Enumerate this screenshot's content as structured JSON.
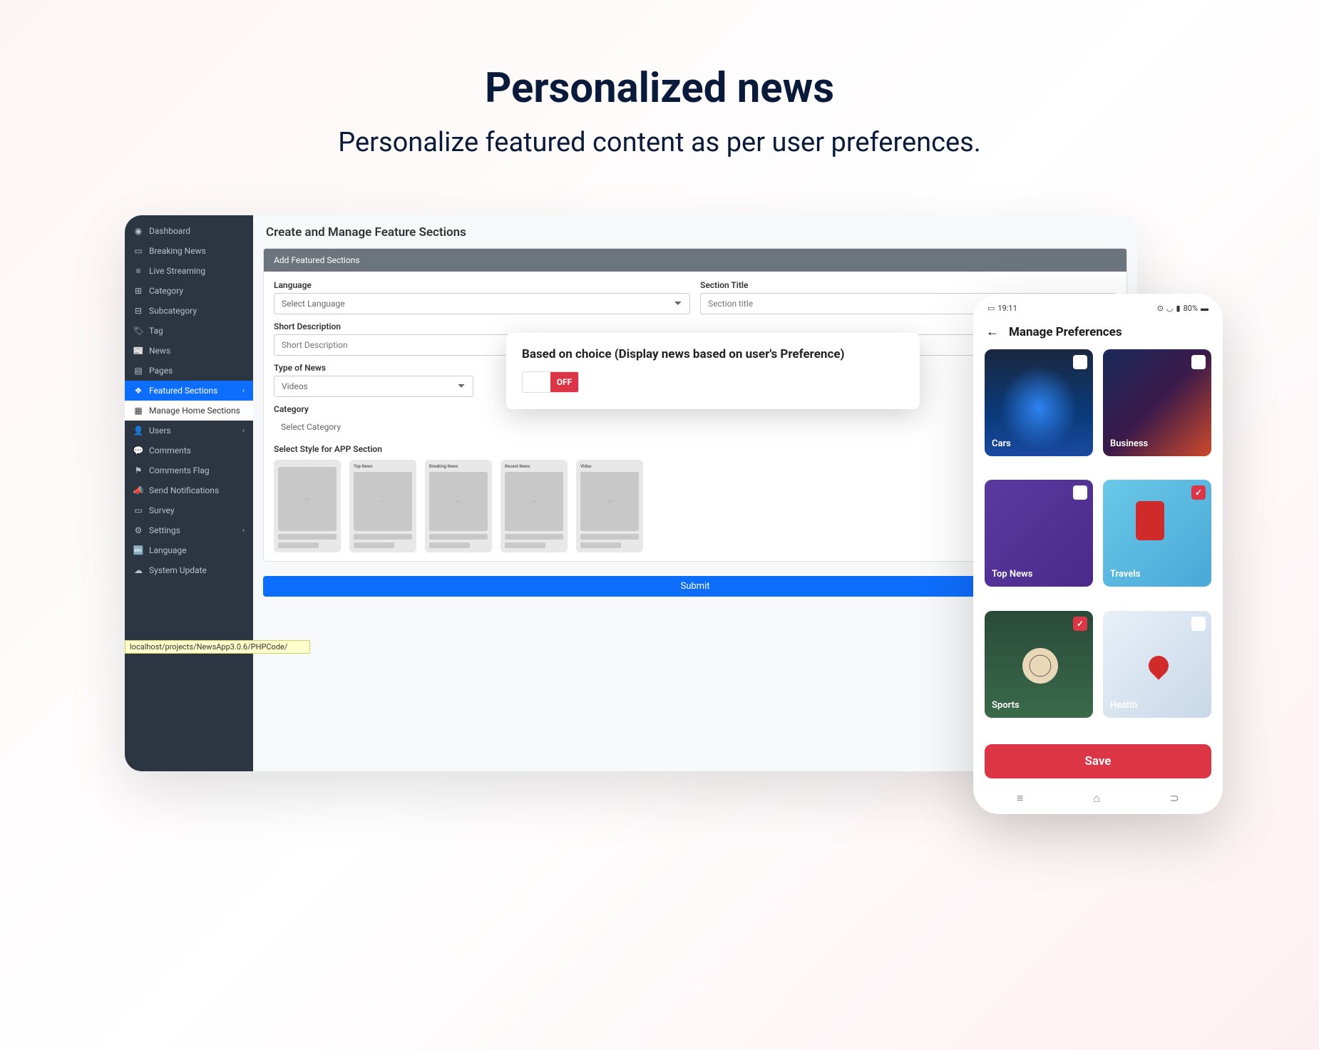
{
  "hero": {
    "title": "Personalized news",
    "subtitle": "Personalize featured content as per user preferences."
  },
  "sidebar": {
    "items": [
      {
        "icon": "◉",
        "label": "Dashboard"
      },
      {
        "icon": "▭",
        "label": "Breaking News"
      },
      {
        "icon": "≡",
        "label": "Live Streaming"
      },
      {
        "icon": "⊞",
        "label": "Category"
      },
      {
        "icon": "⊟",
        "label": "Subcategory"
      },
      {
        "icon": "🏷",
        "label": "Tag"
      },
      {
        "icon": "📰",
        "label": "News"
      },
      {
        "icon": "▤",
        "label": "Pages"
      },
      {
        "icon": "❖",
        "label": "Featured Sections",
        "active": true,
        "chev": "‹"
      },
      {
        "icon": "▦",
        "label": "Manage Home Sections",
        "sub": true
      },
      {
        "icon": "👤",
        "label": "Users",
        "chev": "‹"
      },
      {
        "icon": "💬",
        "label": "Comments"
      },
      {
        "icon": "⚑",
        "label": "Comments Flag"
      },
      {
        "icon": "📣",
        "label": "Send Notifications"
      },
      {
        "icon": "▭",
        "label": "Survey"
      },
      {
        "icon": "⚙",
        "label": "Settings",
        "chev": "‹"
      },
      {
        "icon": "🔤",
        "label": "Language"
      },
      {
        "icon": "☁",
        "label": "System Update"
      }
    ],
    "url": "localhost/projects/NewsApp3.0.6/PHPCode/"
  },
  "main": {
    "title": "Create and Manage Feature Sections",
    "card_head": "Add Featured Sections",
    "lang_label": "Language",
    "lang_value": "Select Language",
    "section_title_label": "Section Title",
    "section_title_ph": "Section title",
    "short_desc_label": "Short Description",
    "short_desc_ph": "Short Description",
    "type_label": "Type of News",
    "type_value": "Videos",
    "cat_label": "Category",
    "cat_value": "Select Category",
    "style_label": "Select Style for APP Section",
    "style_heads": [
      "",
      "Top News",
      "Breaking News",
      "Recent News",
      "Video"
    ],
    "submit": "Submit"
  },
  "pref": {
    "title": "Based on choice (Display news based on user's Preference)",
    "off": "OFF"
  },
  "phone": {
    "time": "19:11",
    "battery": "80%",
    "title": "Manage Preferences",
    "tiles": [
      {
        "label": "Cars",
        "cls": "cars",
        "checked": false
      },
      {
        "label": "Business",
        "cls": "biz",
        "checked": false
      },
      {
        "label": "Top News",
        "cls": "top",
        "checked": false
      },
      {
        "label": "Travels",
        "cls": "trav",
        "checked": true
      },
      {
        "label": "Sports",
        "cls": "sport",
        "checked": true
      },
      {
        "label": "Health",
        "cls": "health",
        "checked": false
      }
    ],
    "save": "Save"
  }
}
